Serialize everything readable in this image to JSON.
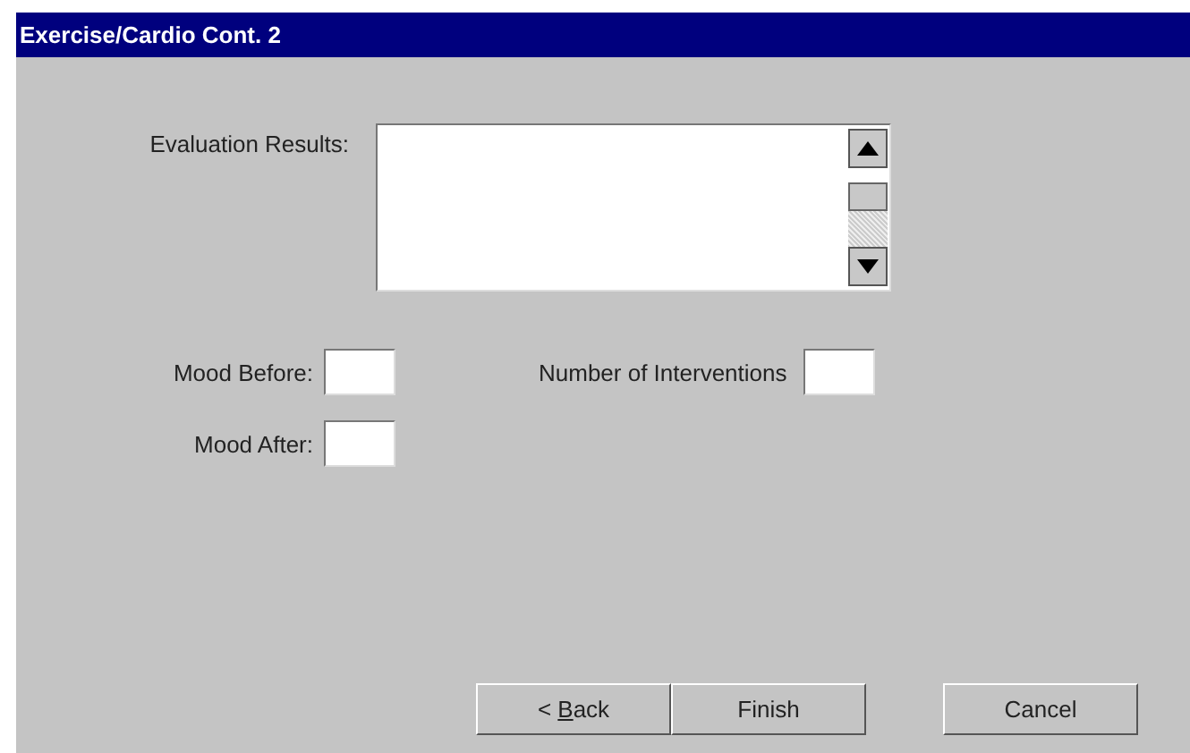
{
  "window": {
    "title": "Exercise/Cardio Cont. 2"
  },
  "evaluation": {
    "label": "Evaluation Results:"
  },
  "fields": [
    {
      "label": "Mood Before:"
    },
    {
      "label": "Number of Interventions"
    },
    {
      "label": "Mood After:"
    }
  ],
  "buttons": [
    {
      "label_parts": [
        "< ",
        "B",
        "ack"
      ]
    },
    {
      "label": "Finish"
    },
    {
      "label": "Cancel"
    }
  ]
}
